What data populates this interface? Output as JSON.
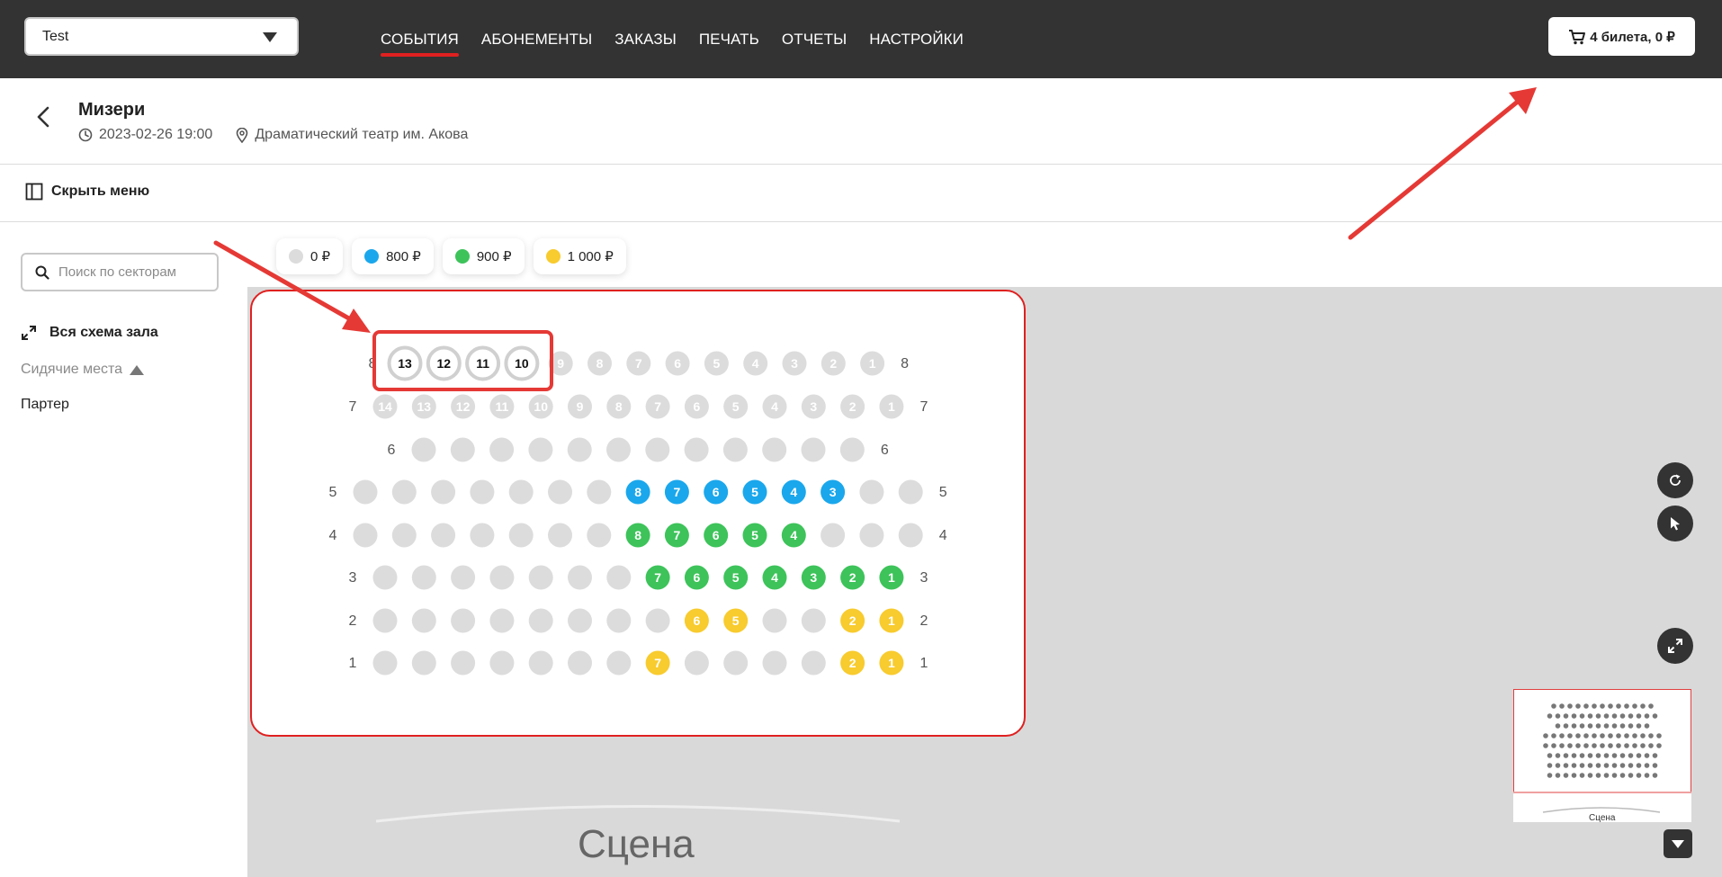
{
  "header": {
    "org_select": "Test",
    "nav": [
      "СОБЫТИЯ",
      "АБОНЕМЕНТЫ",
      "ЗАКАЗЫ",
      "ПЕЧАТЬ",
      "ОТЧЕТЫ",
      "НАСТРОЙКИ"
    ],
    "active_nav": 0,
    "cart_label": "4 билета, 0 ₽"
  },
  "event": {
    "title": "Мизери",
    "datetime": "2023-02-26 19:00",
    "venue": "Драматический театр им. Акова"
  },
  "menu": {
    "hide_label": "Скрыть меню"
  },
  "sidebar": {
    "search_placeholder": "Поиск по секторам",
    "full_scheme": "Вся схема зала",
    "seat_category": "Сидячие места",
    "sector": "Партер"
  },
  "prices": [
    {
      "label": "0 ₽",
      "color": "#dcdcdc"
    },
    {
      "label": "800 ₽",
      "color": "#1aa7ec"
    },
    {
      "label": "900 ₽",
      "color": "#3dc35a"
    },
    {
      "label": "1 000 ₽",
      "color": "#f8cb2e"
    }
  ],
  "seat_colors": {
    "0": "#dcdcdc",
    "800": "#1aa7ec",
    "900": "#3dc35a",
    "1000": "#f8cb2e",
    "selected_fill": "#ffffff",
    "selected_ring": "#d0d0d0"
  },
  "hall": {
    "rows": [
      {
        "row": "8",
        "seats": [
          {
            "n": "13",
            "price": "0",
            "selected": true
          },
          {
            "n": "12",
            "price": "0",
            "selected": true
          },
          {
            "n": "11",
            "price": "0",
            "selected": true
          },
          {
            "n": "10",
            "price": "0",
            "selected": true
          },
          {
            "n": "9",
            "price": "0"
          },
          {
            "n": "8",
            "price": "0"
          },
          {
            "n": "7",
            "price": "0"
          },
          {
            "n": "6",
            "price": "0"
          },
          {
            "n": "5",
            "price": "0"
          },
          {
            "n": "4",
            "price": "0"
          },
          {
            "n": "3",
            "price": "0"
          },
          {
            "n": "2",
            "price": "0"
          },
          {
            "n": "1",
            "price": "0"
          }
        ]
      },
      {
        "row": "7",
        "seats": [
          {
            "n": "14",
            "price": "0"
          },
          {
            "n": "13",
            "price": "0"
          },
          {
            "n": "12",
            "price": "0"
          },
          {
            "n": "11",
            "price": "0"
          },
          {
            "n": "10",
            "price": "0"
          },
          {
            "n": "9",
            "price": "0"
          },
          {
            "n": "8",
            "price": "0"
          },
          {
            "n": "7",
            "price": "0"
          },
          {
            "n": "6",
            "price": "0"
          },
          {
            "n": "5",
            "price": "0"
          },
          {
            "n": "4",
            "price": "0"
          },
          {
            "n": "3",
            "price": "0"
          },
          {
            "n": "2",
            "price": "0"
          },
          {
            "n": "1",
            "price": "0"
          }
        ]
      },
      {
        "row": "6",
        "seats": [
          {
            "n": "",
            "price": "0"
          },
          {
            "n": "",
            "price": "0"
          },
          {
            "n": "",
            "price": "0"
          },
          {
            "n": "",
            "price": "0"
          },
          {
            "n": "",
            "price": "0"
          },
          {
            "n": "",
            "price": "0"
          },
          {
            "n": "",
            "price": "0"
          },
          {
            "n": "",
            "price": "0"
          },
          {
            "n": "",
            "price": "0"
          },
          {
            "n": "",
            "price": "0"
          },
          {
            "n": "",
            "price": "0"
          },
          {
            "n": "",
            "price": "0"
          }
        ]
      },
      {
        "row": "5",
        "seats": [
          {
            "n": "",
            "price": "0"
          },
          {
            "n": "",
            "price": "0"
          },
          {
            "n": "",
            "price": "0"
          },
          {
            "n": "",
            "price": "0"
          },
          {
            "n": "",
            "price": "0"
          },
          {
            "n": "",
            "price": "0"
          },
          {
            "n": "",
            "price": "0"
          },
          {
            "n": "8",
            "price": "800"
          },
          {
            "n": "7",
            "price": "800"
          },
          {
            "n": "6",
            "price": "800"
          },
          {
            "n": "5",
            "price": "800"
          },
          {
            "n": "4",
            "price": "800"
          },
          {
            "n": "3",
            "price": "800"
          },
          {
            "n": "",
            "price": "0"
          },
          {
            "n": "",
            "price": "0"
          }
        ]
      },
      {
        "row": "4",
        "seats": [
          {
            "n": "",
            "price": "0"
          },
          {
            "n": "",
            "price": "0"
          },
          {
            "n": "",
            "price": "0"
          },
          {
            "n": "",
            "price": "0"
          },
          {
            "n": "",
            "price": "0"
          },
          {
            "n": "",
            "price": "0"
          },
          {
            "n": "",
            "price": "0"
          },
          {
            "n": "8",
            "price": "900"
          },
          {
            "n": "7",
            "price": "900"
          },
          {
            "n": "6",
            "price": "900"
          },
          {
            "n": "5",
            "price": "900"
          },
          {
            "n": "4",
            "price": "900"
          },
          {
            "n": "",
            "price": "0"
          },
          {
            "n": "",
            "price": "0"
          },
          {
            "n": "",
            "price": "0"
          }
        ]
      },
      {
        "row": "3",
        "seats": [
          {
            "n": "",
            "price": "0"
          },
          {
            "n": "",
            "price": "0"
          },
          {
            "n": "",
            "price": "0"
          },
          {
            "n": "",
            "price": "0"
          },
          {
            "n": "",
            "price": "0"
          },
          {
            "n": "",
            "price": "0"
          },
          {
            "n": "",
            "price": "0"
          },
          {
            "n": "7",
            "price": "900"
          },
          {
            "n": "6",
            "price": "900"
          },
          {
            "n": "5",
            "price": "900"
          },
          {
            "n": "4",
            "price": "900"
          },
          {
            "n": "3",
            "price": "900"
          },
          {
            "n": "2",
            "price": "900"
          },
          {
            "n": "1",
            "price": "900"
          }
        ]
      },
      {
        "row": "2",
        "seats": [
          {
            "n": "",
            "price": "0"
          },
          {
            "n": "",
            "price": "0"
          },
          {
            "n": "",
            "price": "0"
          },
          {
            "n": "",
            "price": "0"
          },
          {
            "n": "",
            "price": "0"
          },
          {
            "n": "",
            "price": "0"
          },
          {
            "n": "",
            "price": "0"
          },
          {
            "n": "",
            "price": "0"
          },
          {
            "n": "6",
            "price": "1000"
          },
          {
            "n": "5",
            "price": "1000"
          },
          {
            "n": "",
            "price": "0"
          },
          {
            "n": "",
            "price": "0"
          },
          {
            "n": "2",
            "price": "1000"
          },
          {
            "n": "1",
            "price": "1000"
          }
        ]
      },
      {
        "row": "1",
        "seats": [
          {
            "n": "",
            "price": "0"
          },
          {
            "n": "",
            "price": "0"
          },
          {
            "n": "",
            "price": "0"
          },
          {
            "n": "",
            "price": "0"
          },
          {
            "n": "",
            "price": "0"
          },
          {
            "n": "",
            "price": "0"
          },
          {
            "n": "",
            "price": "0"
          },
          {
            "n": "7",
            "price": "1000"
          },
          {
            "n": "",
            "price": "0"
          },
          {
            "n": "",
            "price": "0"
          },
          {
            "n": "",
            "price": "0"
          },
          {
            "n": "",
            "price": "0"
          },
          {
            "n": "2",
            "price": "1000"
          },
          {
            "n": "1",
            "price": "1000"
          }
        ]
      }
    ],
    "stage_label": "Сцена"
  },
  "minimap": {
    "stage_label": "Сцена"
  },
  "annotation_color": "#e53935"
}
